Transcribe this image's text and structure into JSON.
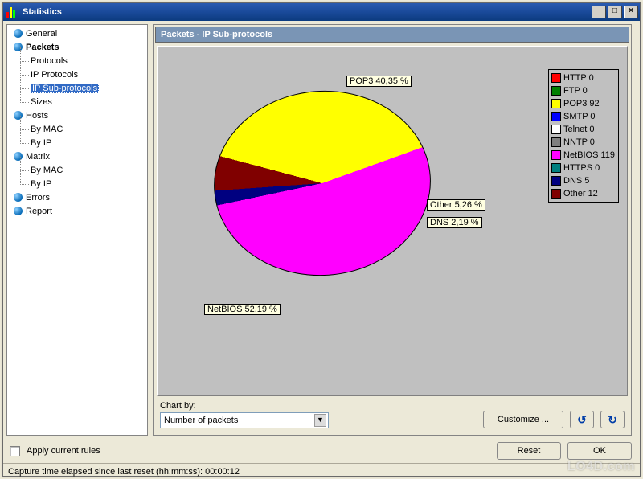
{
  "window": {
    "title": "Statistics"
  },
  "tree": {
    "items": [
      {
        "label": "General",
        "type": "top"
      },
      {
        "label": "Packets",
        "type": "top",
        "bold": true
      },
      {
        "label": "Protocols",
        "type": "sub"
      },
      {
        "label": "IP Protocols",
        "type": "sub"
      },
      {
        "label": "IP Sub-protocols",
        "type": "sub",
        "selected": true
      },
      {
        "label": "Sizes",
        "type": "sub"
      },
      {
        "label": "Hosts",
        "type": "top"
      },
      {
        "label": "By MAC",
        "type": "sub"
      },
      {
        "label": "By IP",
        "type": "sub"
      },
      {
        "label": "Matrix",
        "type": "top"
      },
      {
        "label": "By MAC",
        "type": "sub"
      },
      {
        "label": "By IP",
        "type": "sub"
      },
      {
        "label": "Errors",
        "type": "top"
      },
      {
        "label": "Report",
        "type": "top"
      }
    ]
  },
  "panel": {
    "title": "Packets - IP Sub-protocols"
  },
  "chart_data": {
    "type": "pie",
    "title": "Packets - IP Sub-protocols",
    "series": [
      {
        "name": "HTTP",
        "count": 0,
        "color": "#ff0000"
      },
      {
        "name": "FTP",
        "count": 0,
        "color": "#008000"
      },
      {
        "name": "POP3",
        "count": 92,
        "color": "#ffff00",
        "pct": "40,35 %"
      },
      {
        "name": "SMTP",
        "count": 0,
        "color": "#0000ff"
      },
      {
        "name": "Telnet",
        "count": 0,
        "color": "#ffffff"
      },
      {
        "name": "NNTP",
        "count": 0,
        "color": "#808080"
      },
      {
        "name": "NetBIOS",
        "count": 119,
        "color": "#ff00ff",
        "pct": "52,19 %"
      },
      {
        "name": "HTTPS",
        "count": 0,
        "color": "#008080"
      },
      {
        "name": "DNS",
        "count": 5,
        "color": "#000080",
        "pct": "2,19 %"
      },
      {
        "name": "Other",
        "count": 12,
        "color": "#800000",
        "pct": "5,26 %"
      }
    ],
    "labels": {
      "pop3": "POP3 40,35 %",
      "other": "Other 5,26 %",
      "dns": "DNS 2,19 %",
      "netbios": "NetBIOS 52,19 %"
    }
  },
  "legend_text": {
    "0": "HTTP 0",
    "1": "FTP 0",
    "2": "POP3 92",
    "3": "SMTP 0",
    "4": "Telnet 0",
    "5": "NNTP 0",
    "6": "NetBIOS 119",
    "7": "HTTPS 0",
    "8": "DNS 5",
    "9": "Other 12"
  },
  "chartby": {
    "label": "Chart by:",
    "value": "Number of packets"
  },
  "buttons": {
    "customize": "Customize ...",
    "reset": "Reset",
    "ok": "OK"
  },
  "checkbox": {
    "label": "Apply current rules"
  },
  "status": {
    "text": "Capture time elapsed since last reset (hh:mm:ss): 00:00:12"
  },
  "watermark": "LO4D.com"
}
